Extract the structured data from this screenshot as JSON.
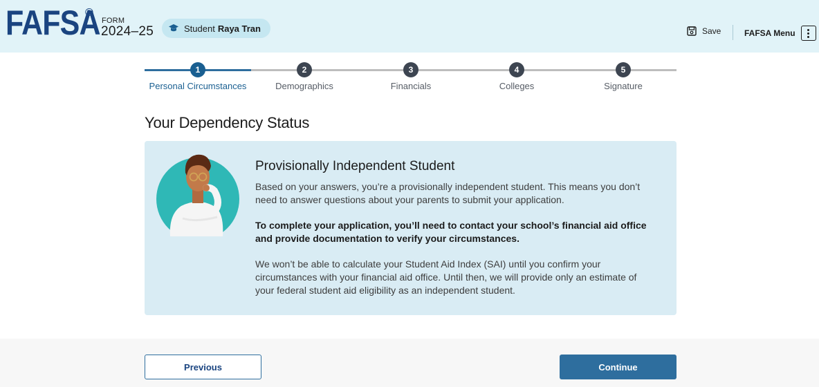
{
  "header": {
    "logo": "FAFSA",
    "registered": "®",
    "form_label": "FORM",
    "form_year": "2024–25",
    "student_prefix": "Student",
    "student_name": "Raya Tran",
    "save_label": "Save",
    "menu_label": "FAFSA Menu"
  },
  "stepper": {
    "current_step": 1,
    "steps": [
      {
        "number": "1",
        "label": "Personal Circumstances"
      },
      {
        "number": "2",
        "label": "Demographics"
      },
      {
        "number": "3",
        "label": "Financials"
      },
      {
        "number": "4",
        "label": "Colleges"
      },
      {
        "number": "5",
        "label": "Signature"
      }
    ]
  },
  "page": {
    "title": "Your Dependency Status"
  },
  "card": {
    "heading": "Provisionally Independent Student",
    "paragraph1": "Based on your answers, you’re a provisionally independent student. This means you don’t need to answer questions about your parents to submit your application.",
    "paragraph2": "To complete your application, you’ll need to contact your school’s financial aid office and provide documentation to verify your circumstances.",
    "paragraph3": "We won’t be able to calculate your Student Aid Index (SAI) until you confirm your circumstances with your financial aid office. Until then, we will provide only an estimate of your federal student aid eligibility as an independent student."
  },
  "footer": {
    "previous_label": "Previous",
    "continue_label": "Continue"
  },
  "colors": {
    "header_bg": "#e1f3f8",
    "brand": "#1a4480",
    "primary": "#2e6e9e",
    "card_bg": "#d9ecf4"
  },
  "icons": {
    "student": "graduation-cap-icon",
    "save": "floppy-disk-icon",
    "menu": "kebab-menu-icon"
  }
}
